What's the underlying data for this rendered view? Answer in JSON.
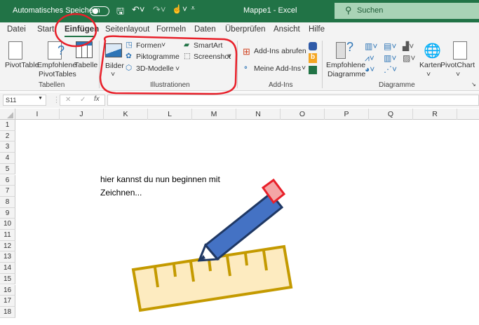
{
  "titlebar": {
    "autosave": "Automatisches Speichern",
    "doc_title": "Mappe1  -  Excel",
    "search_placeholder": "Suchen",
    "color": "#217346"
  },
  "tabs": [
    "Datei",
    "Start",
    "Einfügen",
    "Seitenlayout",
    "Formeln",
    "Daten",
    "Überprüfen",
    "Ansicht",
    "Hilfe"
  ],
  "active_tab": "Einfügen",
  "ribbon": {
    "tabellen": {
      "label": "Tabellen",
      "pivottable": "PivotTable",
      "empf1": "Empfohlene",
      "empf2": "PivotTables",
      "tabelle": "Tabelle"
    },
    "illustrationen": {
      "label": "Illustrationen",
      "bilder": "Bilder",
      "formen": "Formen",
      "piktogramme": "Piktogramme",
      "modelle": "3D-Modelle",
      "smartart": "SmartArt",
      "screenshot": "Screenshot"
    },
    "addins": {
      "label": "Add-Ins",
      "abrufen": "Add-Ins abrufen",
      "meine": "Meine Add-Ins"
    },
    "diagramme": {
      "label": "Diagramme",
      "empf1": "Empfohlene",
      "empf2": "Diagramme",
      "karten": "Karten",
      "pivotchart": "PivotChart"
    }
  },
  "formula_bar": {
    "name_box": "S11",
    "value": ""
  },
  "columns": [
    "I",
    "J",
    "K",
    "L",
    "M",
    "N",
    "O",
    "P",
    "Q",
    "R"
  ],
  "rows": [
    "1",
    "2",
    "3",
    "4",
    "5",
    "6",
    "7",
    "8",
    "9",
    "10",
    "11",
    "12",
    "13",
    "14",
    "15",
    "16",
    "17",
    "18"
  ],
  "sheet": {
    "text_line1": "hier kannst du nun beginnen mit",
    "text_line2": "Zeichnen..."
  },
  "annotation_color": "#e8202a"
}
